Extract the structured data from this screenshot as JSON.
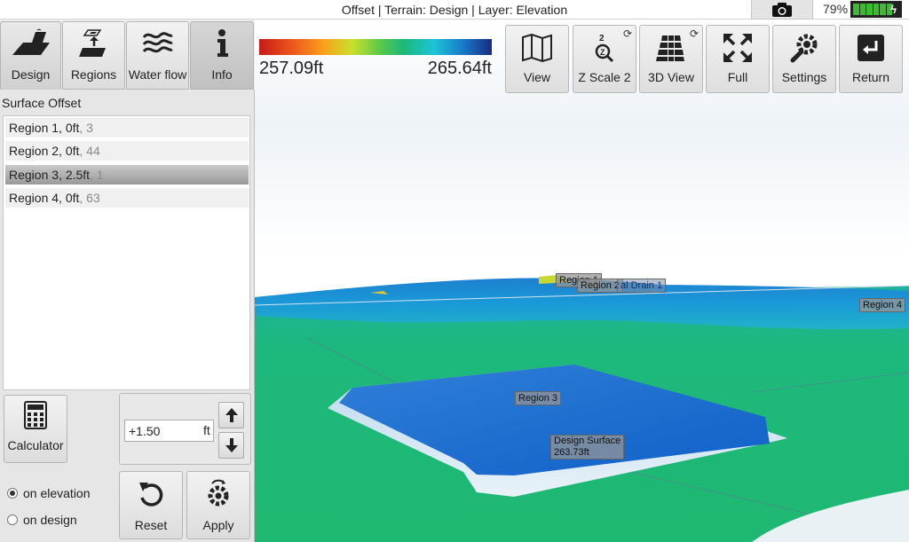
{
  "status": {
    "title": "Offset | Terrain: Design | Layer: Elevation",
    "battery_percent": "79%",
    "battery_level": 0.79
  },
  "tabs": [
    {
      "label": "Design",
      "icon": "design-surface-icon"
    },
    {
      "label": "Regions",
      "icon": "regions-icon"
    },
    {
      "label": "Water flow",
      "icon": "water-flow-icon"
    },
    {
      "label": "Info",
      "icon": "info-icon"
    }
  ],
  "panel": {
    "title": "Surface Offset",
    "regions": [
      {
        "name": "Region 1, 0ft",
        "count": ", 3"
      },
      {
        "name": "Region 2, 0ft",
        "count": ", 44"
      },
      {
        "name": "Region 3, 2.5ft",
        "count": ", 1"
      },
      {
        "name": "Region 4, 0ft",
        "count": ", 63"
      }
    ],
    "selected_region": "Region 3, 2.5ft",
    "calculator_label": "Calculator",
    "offset_value": "+1.50",
    "offset_unit": "ft",
    "reference_options": [
      "on elevation",
      "on design"
    ],
    "reference_selected": "on elevation",
    "reset_label": "Reset",
    "apply_label": "Apply"
  },
  "legend": {
    "min": "257.09ft",
    "max": "265.64ft",
    "colors": [
      "#c81a18",
      "#f8a21c",
      "#c9e02c",
      "#5ac94a",
      "#1cc4d8",
      "#1878c8",
      "#1a2a80"
    ]
  },
  "toolbar": [
    {
      "label": "View",
      "icon": "map-view-icon"
    },
    {
      "label": "Z Scale 2",
      "icon": "z-scale-icon"
    },
    {
      "label": "3D View",
      "icon": "grid-3d-icon"
    },
    {
      "label": "Full",
      "icon": "fullscreen-icon"
    },
    {
      "label": "Settings",
      "icon": "settings-icon"
    },
    {
      "label": "Return",
      "icon": "return-icon"
    }
  ],
  "scene_labels": {
    "region1": "Region 1",
    "region2": "Region 2",
    "drain": "al Drain 1",
    "region4": "Region 4",
    "region3": "Region 3",
    "design_surface": "Design Surface",
    "design_elev": "263.73ft"
  }
}
